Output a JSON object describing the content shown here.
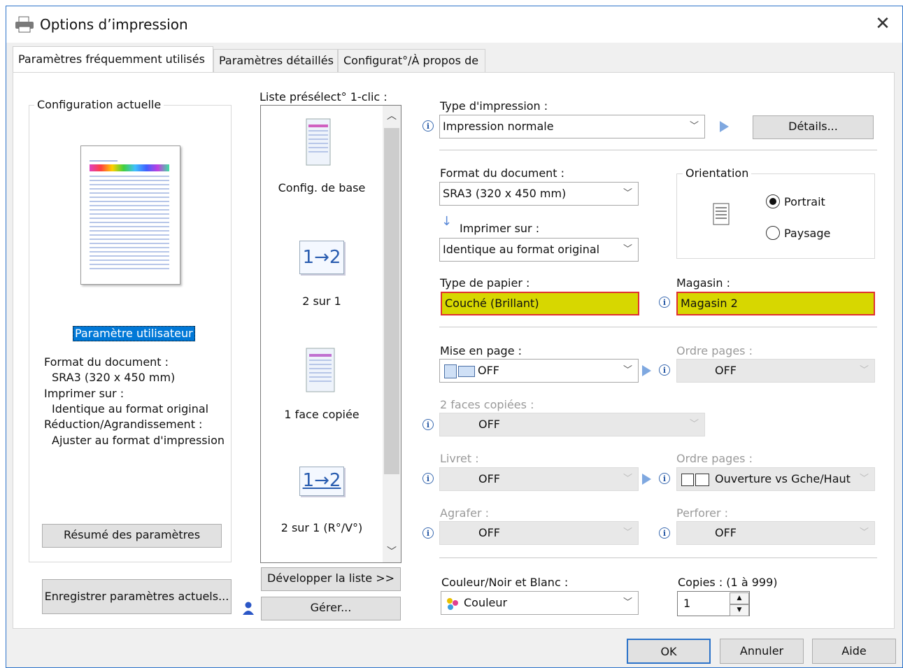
{
  "window": {
    "title": "Options d’impression",
    "close_glyph": "✕"
  },
  "tabs": [
    {
      "label": "Paramètres fréquemment utilisés",
      "active": true
    },
    {
      "label": "Paramètres détaillés",
      "active": false
    },
    {
      "label": "Configurat°/À propos de",
      "active": false
    }
  ],
  "current_config": {
    "legend": "Configuration actuelle",
    "user_setting": "Paramètre utilisateur",
    "lines": [
      "Format du document :",
      "SRA3 (320 x 450 mm)",
      "Imprimer sur :",
      "Identique au format original",
      "Réduction/Agrandissement :",
      "Ajuster au format d'impression"
    ],
    "summary_button": "Résumé des paramètres",
    "save_button": "Enregistrer paramètres actuels..."
  },
  "preset_list": {
    "label": "Liste présélect° 1-clic :",
    "items": [
      {
        "label": "Config. de base",
        "icon": "document-color-icon"
      },
      {
        "label": "2 sur 1",
        "icon_text": "1→2",
        "icon": "two-up-icon"
      },
      {
        "label": "1 face copiée",
        "icon": "one-side-copy-icon"
      },
      {
        "label": "2 sur 1 (R°/V°)",
        "icon_text": "1→2",
        "icon": "two-up-duplex-icon"
      }
    ],
    "expand_button": "Développer la liste >>",
    "manage_button": "Gérer..."
  },
  "print_type": {
    "label": "Type d'impression :",
    "value": "Impression normale",
    "details_button": "Détails..."
  },
  "doc_format": {
    "label": "Format du document :",
    "value": "SRA3 (320 x 450 mm)"
  },
  "print_on": {
    "label": "Imprimer sur :",
    "value": "Identique au format original"
  },
  "orientation": {
    "legend": "Orientation",
    "options": [
      "Portrait",
      "Paysage"
    ],
    "selected": "Portrait"
  },
  "paper_type": {
    "label": "Type de papier :",
    "value": "Couché (Brillant)"
  },
  "tray": {
    "label": "Magasin :",
    "value": "Magasin 2"
  },
  "layout": {
    "label": "Mise en page :",
    "value": "OFF"
  },
  "page_order1": {
    "label": "Ordre pages :",
    "value": "OFF"
  },
  "duplex": {
    "label": "2 faces copiées :",
    "value": "OFF"
  },
  "booklet": {
    "label": "Livret :",
    "value": "OFF"
  },
  "page_order2": {
    "label": "Ordre pages :",
    "value": "Ouverture vs Gche/Haut"
  },
  "staple": {
    "label": "Agrafer :",
    "value": "OFF"
  },
  "punch": {
    "label": "Perforer :",
    "value": "OFF"
  },
  "color": {
    "label": "Couleur/Noir et Blanc :",
    "value": "Couleur"
  },
  "copies": {
    "label": "Copies : (1 à 999)",
    "value": "1"
  },
  "footer": {
    "ok": "OK",
    "cancel": "Annuler",
    "help": "Aide"
  },
  "colors": {
    "accent": "#2b72c9",
    "highlight_bg": "#d7d700",
    "highlight_border": "#e03030",
    "selection": "#0078d7"
  }
}
